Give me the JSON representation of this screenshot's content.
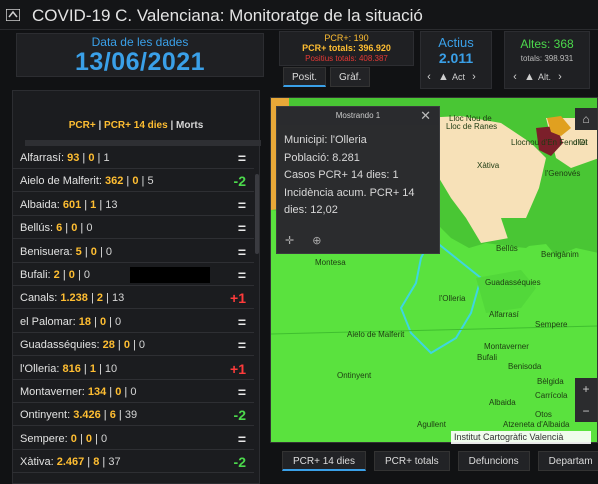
{
  "header": {
    "title": "COVID-19 C. Valenciana: Monitoratge de la situació"
  },
  "date_card": {
    "label": "Data de les dades",
    "value": "13/06/2021"
  },
  "pcr_card": {
    "line1": "PCR+: 190",
    "line2": "PCR+ totals: 396.920",
    "line3": "Positius totals: 408.387"
  },
  "actius": {
    "label": "Actius",
    "value": "2.011",
    "nav_label": "Act"
  },
  "altes": {
    "label": "Altes: 368",
    "sub": "totals: 398.931",
    "nav_label": "Alt."
  },
  "small_tabs": [
    "Posit.",
    "Gràf."
  ],
  "list_legend": {
    "pcr": "PCR+",
    "sep": " | ",
    "pcr14": "PCR+ 14 dies",
    "morts": "Morts"
  },
  "rows": [
    {
      "name": "Alfarrasí",
      "a": "93",
      "b": "0",
      "c": "1",
      "trend": "=",
      "kind": "eq"
    },
    {
      "name": "Aielo de Malferit",
      "a": "362",
      "b": "0",
      "c": "5",
      "trend": "-2",
      "kind": "dn"
    },
    {
      "name": "Albaida",
      "a": "601",
      "b": "1",
      "c": "13",
      "trend": "=",
      "kind": "eq"
    },
    {
      "name": "Bellús",
      "a": "6",
      "b": "0",
      "c": "0",
      "trend": "=",
      "kind": "eq"
    },
    {
      "name": "Benisuera",
      "a": "5",
      "b": "0",
      "c": "0",
      "trend": "=",
      "kind": "eq"
    },
    {
      "name": "Bufali",
      "a": "2",
      "b": "0",
      "c": "0",
      "trend": "=",
      "kind": "eq"
    },
    {
      "name": "Canals",
      "a": "1.238",
      "b": "2",
      "c": "13",
      "trend": "+1",
      "kind": "up"
    },
    {
      "name": "el Palomar",
      "a": "18",
      "b": "0",
      "c": "0",
      "trend": "=",
      "kind": "eq"
    },
    {
      "name": "Guadasséquies",
      "a": "28",
      "b": "0",
      "c": "0",
      "trend": "=",
      "kind": "eq"
    },
    {
      "name": "l'Olleria",
      "a": "816",
      "b": "1",
      "c": "10",
      "trend": "+1",
      "kind": "up"
    },
    {
      "name": "Montaverner",
      "a": "134",
      "b": "0",
      "c": "0",
      "trend": "=",
      "kind": "eq"
    },
    {
      "name": "Ontinyent",
      "a": "3.426",
      "b": "6",
      "c": "39",
      "trend": "-2",
      "kind": "dn"
    },
    {
      "name": "Sempere",
      "a": "0",
      "b": "0",
      "c": "0",
      "trend": "=",
      "kind": "eq"
    },
    {
      "name": "Xàtiva",
      "a": "2.467",
      "b": "8",
      "c": "37",
      "trend": "-2",
      "kind": "dn"
    }
  ],
  "popup": {
    "title": "Mostrando 1",
    "lines": [
      "Municipi: l'Olleria",
      "Població: 8.281",
      "Casos PCR+ 14 dies: 1",
      "Incidència acum. PCR+ 14",
      "dies: 12,02"
    ]
  },
  "map_labels": [
    "Lloc Nou de",
    "Lloc de Ranes",
    "Llocnou d'En Fenollet",
    "d'Ol",
    "Xàtiva",
    "l'Genovés",
    "Bellús",
    "Benigànim",
    "Guadasséquies",
    "Montesa",
    "l'Olleria",
    "Sempere",
    "Alfarrasí",
    "Aielo de Malferit",
    "Montaverner",
    "Bufali",
    "Benisoda",
    "Ontinyent",
    "Bèlgida",
    "Albaida",
    "Carrícola",
    "Agullent",
    "Atzeneta d'Albaida",
    "Otos",
    "Bellús"
  ],
  "attribution": "Institut Cartogràfic Valencià",
  "bottom_tabs": [
    "PCR+ 14 dies",
    "PCR+ totals",
    "Defuncions",
    "Departam"
  ],
  "colors": {
    "accent": "#3aa0e8",
    "pcr": "#ffbe32",
    "green": "#4cd94c",
    "red": "#ff3b3b",
    "map_green": "#59e03c"
  }
}
